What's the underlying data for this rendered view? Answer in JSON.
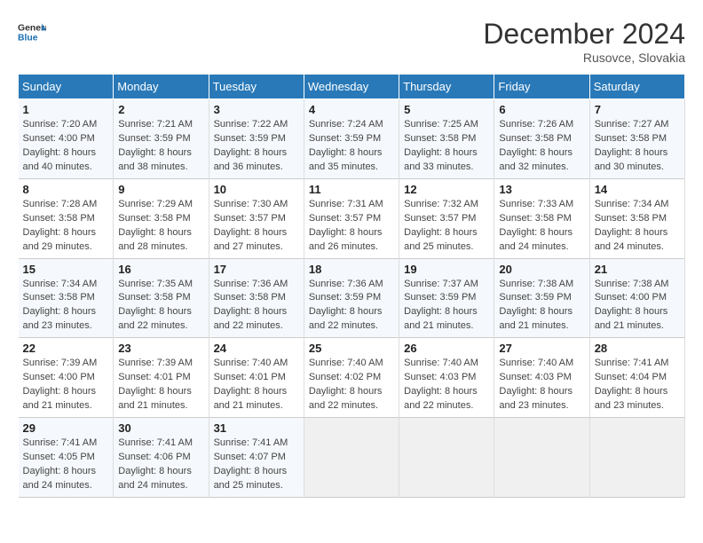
{
  "header": {
    "logo_line1": "General",
    "logo_line2": "Blue",
    "month": "December 2024",
    "location": "Rusovce, Slovakia"
  },
  "weekdays": [
    "Sunday",
    "Monday",
    "Tuesday",
    "Wednesday",
    "Thursday",
    "Friday",
    "Saturday"
  ],
  "weeks": [
    [
      {
        "day": "1",
        "info": "Sunrise: 7:20 AM\nSunset: 4:00 PM\nDaylight: 8 hours\nand 40 minutes."
      },
      {
        "day": "2",
        "info": "Sunrise: 7:21 AM\nSunset: 3:59 PM\nDaylight: 8 hours\nand 38 minutes."
      },
      {
        "day": "3",
        "info": "Sunrise: 7:22 AM\nSunset: 3:59 PM\nDaylight: 8 hours\nand 36 minutes."
      },
      {
        "day": "4",
        "info": "Sunrise: 7:24 AM\nSunset: 3:59 PM\nDaylight: 8 hours\nand 35 minutes."
      },
      {
        "day": "5",
        "info": "Sunrise: 7:25 AM\nSunset: 3:58 PM\nDaylight: 8 hours\nand 33 minutes."
      },
      {
        "day": "6",
        "info": "Sunrise: 7:26 AM\nSunset: 3:58 PM\nDaylight: 8 hours\nand 32 minutes."
      },
      {
        "day": "7",
        "info": "Sunrise: 7:27 AM\nSunset: 3:58 PM\nDaylight: 8 hours\nand 30 minutes."
      }
    ],
    [
      {
        "day": "8",
        "info": "Sunrise: 7:28 AM\nSunset: 3:58 PM\nDaylight: 8 hours\nand 29 minutes."
      },
      {
        "day": "9",
        "info": "Sunrise: 7:29 AM\nSunset: 3:58 PM\nDaylight: 8 hours\nand 28 minutes."
      },
      {
        "day": "10",
        "info": "Sunrise: 7:30 AM\nSunset: 3:57 PM\nDaylight: 8 hours\nand 27 minutes."
      },
      {
        "day": "11",
        "info": "Sunrise: 7:31 AM\nSunset: 3:57 PM\nDaylight: 8 hours\nand 26 minutes."
      },
      {
        "day": "12",
        "info": "Sunrise: 7:32 AM\nSunset: 3:57 PM\nDaylight: 8 hours\nand 25 minutes."
      },
      {
        "day": "13",
        "info": "Sunrise: 7:33 AM\nSunset: 3:58 PM\nDaylight: 8 hours\nand 24 minutes."
      },
      {
        "day": "14",
        "info": "Sunrise: 7:34 AM\nSunset: 3:58 PM\nDaylight: 8 hours\nand 24 minutes."
      }
    ],
    [
      {
        "day": "15",
        "info": "Sunrise: 7:34 AM\nSunset: 3:58 PM\nDaylight: 8 hours\nand 23 minutes."
      },
      {
        "day": "16",
        "info": "Sunrise: 7:35 AM\nSunset: 3:58 PM\nDaylight: 8 hours\nand 22 minutes."
      },
      {
        "day": "17",
        "info": "Sunrise: 7:36 AM\nSunset: 3:58 PM\nDaylight: 8 hours\nand 22 minutes."
      },
      {
        "day": "18",
        "info": "Sunrise: 7:36 AM\nSunset: 3:59 PM\nDaylight: 8 hours\nand 22 minutes."
      },
      {
        "day": "19",
        "info": "Sunrise: 7:37 AM\nSunset: 3:59 PM\nDaylight: 8 hours\nand 21 minutes."
      },
      {
        "day": "20",
        "info": "Sunrise: 7:38 AM\nSunset: 3:59 PM\nDaylight: 8 hours\nand 21 minutes."
      },
      {
        "day": "21",
        "info": "Sunrise: 7:38 AM\nSunset: 4:00 PM\nDaylight: 8 hours\nand 21 minutes."
      }
    ],
    [
      {
        "day": "22",
        "info": "Sunrise: 7:39 AM\nSunset: 4:00 PM\nDaylight: 8 hours\nand 21 minutes."
      },
      {
        "day": "23",
        "info": "Sunrise: 7:39 AM\nSunset: 4:01 PM\nDaylight: 8 hours\nand 21 minutes."
      },
      {
        "day": "24",
        "info": "Sunrise: 7:40 AM\nSunset: 4:01 PM\nDaylight: 8 hours\nand 21 minutes."
      },
      {
        "day": "25",
        "info": "Sunrise: 7:40 AM\nSunset: 4:02 PM\nDaylight: 8 hours\nand 22 minutes."
      },
      {
        "day": "26",
        "info": "Sunrise: 7:40 AM\nSunset: 4:03 PM\nDaylight: 8 hours\nand 22 minutes."
      },
      {
        "day": "27",
        "info": "Sunrise: 7:40 AM\nSunset: 4:03 PM\nDaylight: 8 hours\nand 23 minutes."
      },
      {
        "day": "28",
        "info": "Sunrise: 7:41 AM\nSunset: 4:04 PM\nDaylight: 8 hours\nand 23 minutes."
      }
    ],
    [
      {
        "day": "29",
        "info": "Sunrise: 7:41 AM\nSunset: 4:05 PM\nDaylight: 8 hours\nand 24 minutes."
      },
      {
        "day": "30",
        "info": "Sunrise: 7:41 AM\nSunset: 4:06 PM\nDaylight: 8 hours\nand 24 minutes."
      },
      {
        "day": "31",
        "info": "Sunrise: 7:41 AM\nSunset: 4:07 PM\nDaylight: 8 hours\nand 25 minutes."
      },
      {
        "day": "",
        "info": ""
      },
      {
        "day": "",
        "info": ""
      },
      {
        "day": "",
        "info": ""
      },
      {
        "day": "",
        "info": ""
      }
    ]
  ]
}
